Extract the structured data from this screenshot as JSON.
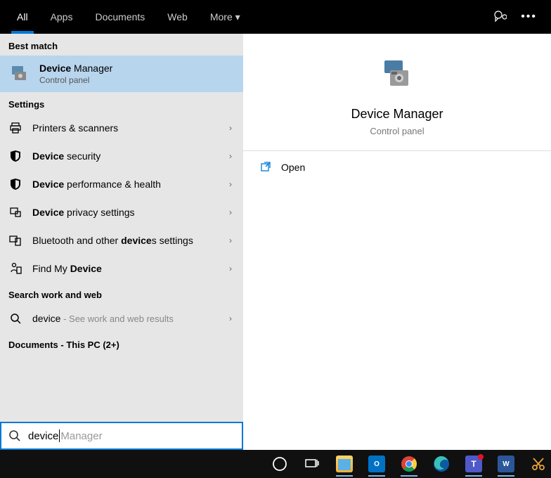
{
  "tabs": [
    "All",
    "Apps",
    "Documents",
    "Web",
    "More"
  ],
  "sections": {
    "best_match": "Best match",
    "settings": "Settings",
    "search_web": "Search work and web",
    "documents": "Documents - This PC (2+)"
  },
  "best_match_item": {
    "title_bold": "Device",
    "title_rest": " Manager",
    "sub": "Control panel"
  },
  "settings_items": [
    {
      "label_pre": "Printers & scanners",
      "label_bold": "",
      "label_post": ""
    },
    {
      "label_pre": "",
      "label_bold": "Device",
      "label_post": " security"
    },
    {
      "label_pre": "",
      "label_bold": "Device",
      "label_post": " performance & health"
    },
    {
      "label_pre": "",
      "label_bold": "Device",
      "label_post": " privacy settings"
    },
    {
      "label_pre": "Bluetooth and other ",
      "label_bold": "device",
      "label_post": "s settings"
    },
    {
      "label_pre": "Find My ",
      "label_bold": "Device",
      "label_post": ""
    }
  ],
  "web_item": {
    "term": "device",
    "hint": " - See work and web results"
  },
  "preview": {
    "title": "Device Manager",
    "sub": "Control panel"
  },
  "actions": {
    "open": "Open"
  },
  "search": {
    "typed": "device",
    "ghost": " Manager"
  }
}
